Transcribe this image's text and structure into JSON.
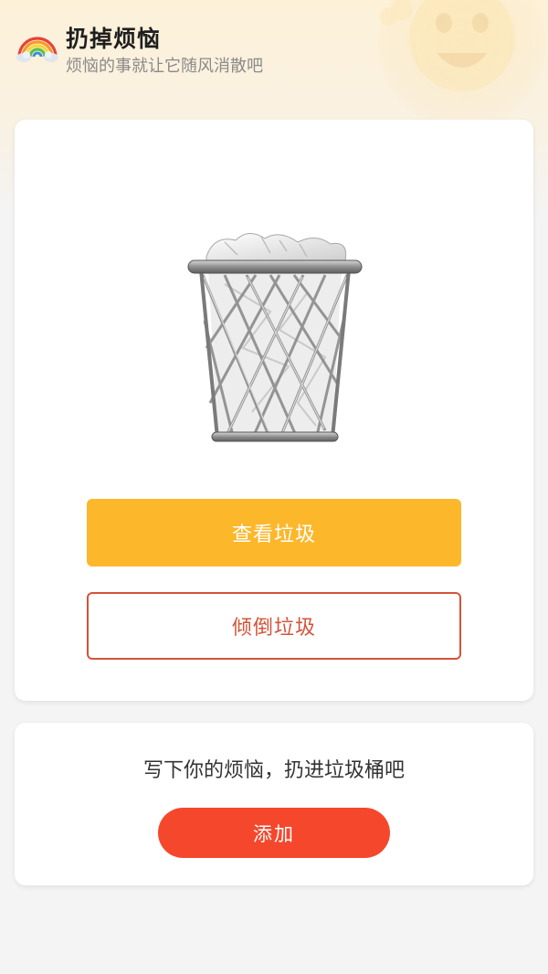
{
  "header": {
    "title": "扔掉烦恼",
    "subtitle": "烦恼的事就让它随风消散吧",
    "icon": "rainbow-icon",
    "decoration": "sun-face-icon"
  },
  "trash_card": {
    "image": "wire-trash-can-icon",
    "view_button_label": "查看垃圾",
    "dump_button_label": "倾倒垃圾"
  },
  "add_card": {
    "prompt": "写下你的烦恼，扔进垃圾桶吧",
    "add_button_label": "添加"
  },
  "colors": {
    "view_button": "#fcb72b",
    "dump_button_border": "#d5533a",
    "add_button": "#f5472c",
    "header_bg": "#fdf1d8"
  }
}
